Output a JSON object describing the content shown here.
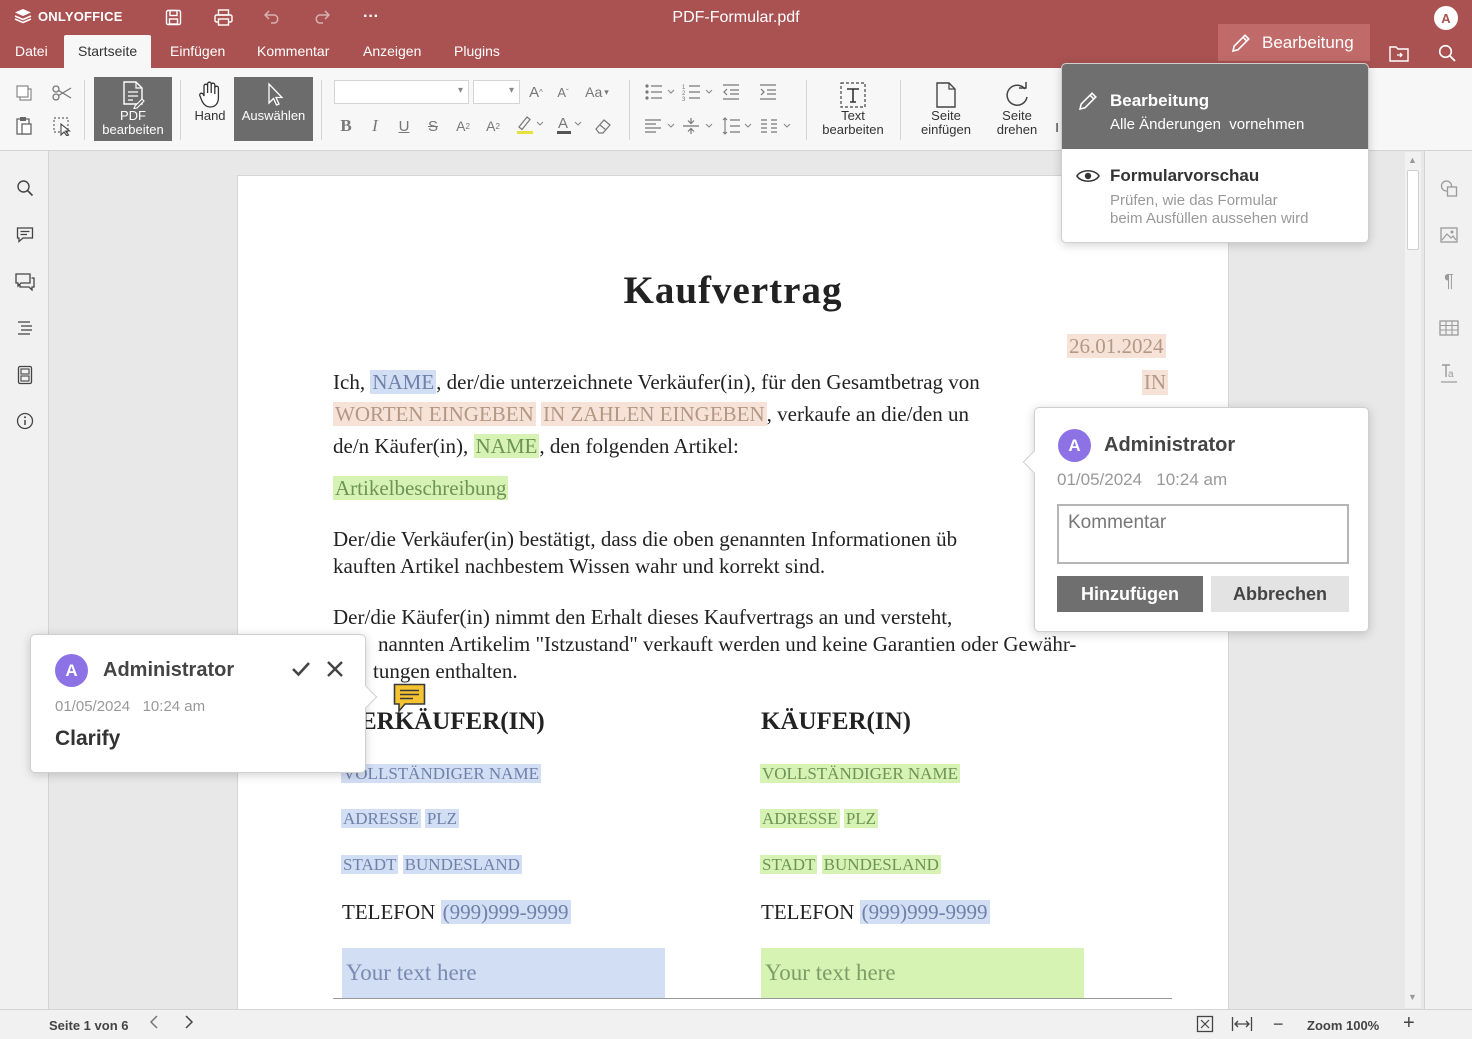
{
  "app": {
    "logo_text": "ONLYOFFICE",
    "document_title": "PDF-Formular.pdf",
    "user_initial": "A"
  },
  "menu": {
    "tabs": [
      "Datei",
      "Startseite",
      "Einfügen",
      "Kommentar",
      "Anzeigen",
      "Plugins"
    ],
    "active_tab": "Startseite",
    "mode_label": "Bearbeitung"
  },
  "toolbar": {
    "pdf_edit_label_1": "PDF",
    "pdf_edit_label_2": "bearbeiten",
    "hand_label": "Hand",
    "select_label": "Auswählen",
    "text_edit_label_1": "Text",
    "text_edit_label_2": "bearbeiten",
    "insert_page_label_1": "Seite",
    "insert_page_label_2": "einfügen",
    "rotate_page_label_1": "Seite",
    "rotate_page_label_2": "drehen",
    "font_name_value": "",
    "font_size_value": "",
    "truncated_label": "I"
  },
  "mode_dropdown": {
    "edit_title": "Bearbeitung",
    "edit_desc": "Alle Änderungen  vornehmen",
    "preview_title": "Formularvorschau",
    "preview_desc_1": "Prüfen, wie das Formular",
    "preview_desc_2": "beim Ausfüllen aussehen wird"
  },
  "document": {
    "title": "Kaufvertrag",
    "date": "26.01.2024",
    "p1": {
      "t1": "Ich, ",
      "f_name": "NAME",
      "t2": ", der/die  unterzeichnete Verkäufer(in), für den Gesamtbetrag von ",
      "f_amount_words_1": "IN",
      "f_amount_words_2": "WORTEN EINGEBEN",
      "f_amount_number": "IN ZAHLEN EINGEBEN",
      "t3": ", verkaufe an die/den un",
      "t4": "de/n Käufer(in), ",
      "f_buyer_name": "NAME",
      "t5": ", den folgenden Artikel:"
    },
    "article_field": "Artikelbeschreibung",
    "p2": {
      "l1": "Der/die Verkäufer(in) bestätigt, dass die oben genannten Informationen üb",
      "l2": "kauften Artikel nachbestem Wissen wahr und korrekt sind."
    },
    "p3": {
      "l1": "Der/die Käufer(in) nimmt den Erhalt dieses Kaufvertrags an und versteht,",
      "l2": "nannten Artikelim \"Istzustand\" verkauft werden und keine Garantien oder Gewähr-",
      "l3": "tungen enthalten."
    },
    "seller": {
      "heading": "ERKÄUFER(IN)",
      "full_name": "VOLLSTÄNDIGER NAME",
      "address": "ADRESSE",
      "zip": "PLZ",
      "city": "STADT",
      "state": "BUNDESLAND",
      "phone_label": "TELEFON",
      "phone": "(999)999-9999",
      "text_placeholder": "Your text here"
    },
    "buyer": {
      "heading": "KÄUFER(IN)",
      "full_name": "VOLLSTÄNDIGER NAME",
      "address": "ADRESSE",
      "zip": "PLZ",
      "city": "STADT",
      "state": "BUNDESLAND",
      "phone_label": "TELEFON",
      "phone": "(999)999-9999",
      "text_placeholder": "Your text here"
    }
  },
  "comment_new": {
    "author": "Administrator",
    "initial": "A",
    "date": "01/05/2024",
    "time": "10:24 am",
    "placeholder": "Kommentar",
    "add_label": "Hinzufügen",
    "cancel_label": "Abbrechen"
  },
  "comment_existing": {
    "author": "Administrator",
    "initial": "A",
    "date": "01/05/2024",
    "time": "10:24 am",
    "text": "Clarify"
  },
  "statusbar": {
    "page_info": "Seite 1 von 6",
    "zoom_label": "Zoom 100%"
  },
  "colors": {
    "brand": "#aa5252",
    "avatar": "#8d72e6",
    "field_blue": "#d2def4",
    "field_green": "#d7f3b4",
    "field_peach": "#f7e2d8"
  }
}
